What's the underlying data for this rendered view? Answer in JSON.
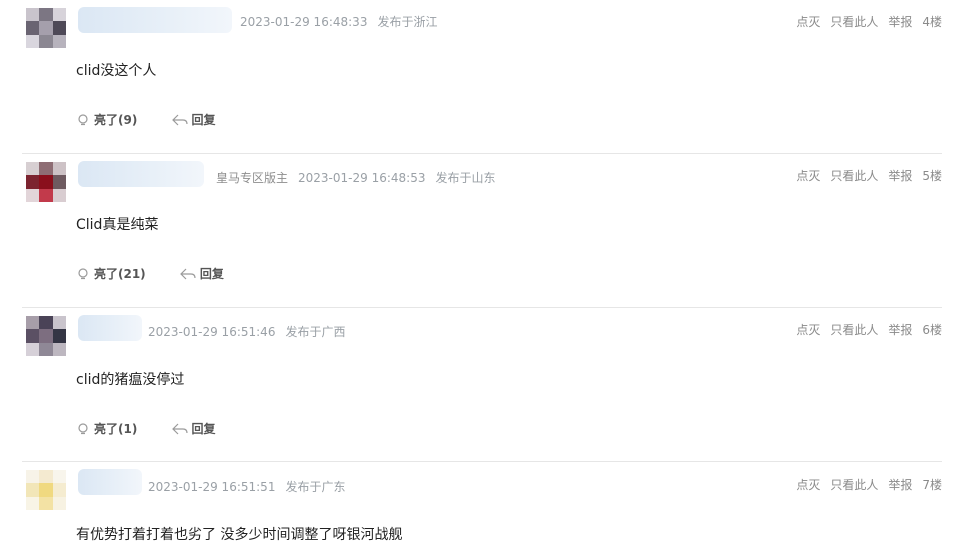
{
  "replies": [
    {
      "role": "",
      "time": "2023-01-29 16:48:33",
      "location": "发布于浙江",
      "content": "clid没这个人",
      "like_label": "亮了(9)",
      "reply_label": "回复",
      "actions": {
        "extinguish": "点灭",
        "only_view": "只看此人",
        "report": "举报",
        "floor": "4楼"
      }
    },
    {
      "role": "皇马专区版主",
      "time": "2023-01-29 16:48:53",
      "location": "发布于山东",
      "content": "Clid真是纯菜",
      "like_label": "亮了(21)",
      "reply_label": "回复",
      "actions": {
        "extinguish": "点灭",
        "only_view": "只看此人",
        "report": "举报",
        "floor": "5楼"
      }
    },
    {
      "role": "",
      "time": "2023-01-29 16:51:46",
      "location": "发布于广西",
      "content": "clid的猪瘟没停过",
      "like_label": "亮了(1)",
      "reply_label": "回复",
      "actions": {
        "extinguish": "点灭",
        "only_view": "只看此人",
        "report": "举报",
        "floor": "6楼"
      }
    },
    {
      "role": "",
      "time": "2023-01-29 16:51:51",
      "location": "发布于广东",
      "content": "有优势打着打着也劣了 没多少时间调整了呀银河战舰",
      "like_label": "",
      "reply_label": "",
      "actions": {
        "extinguish": "点灭",
        "only_view": "只看此人",
        "report": "举报",
        "floor": "7楼"
      }
    }
  ]
}
